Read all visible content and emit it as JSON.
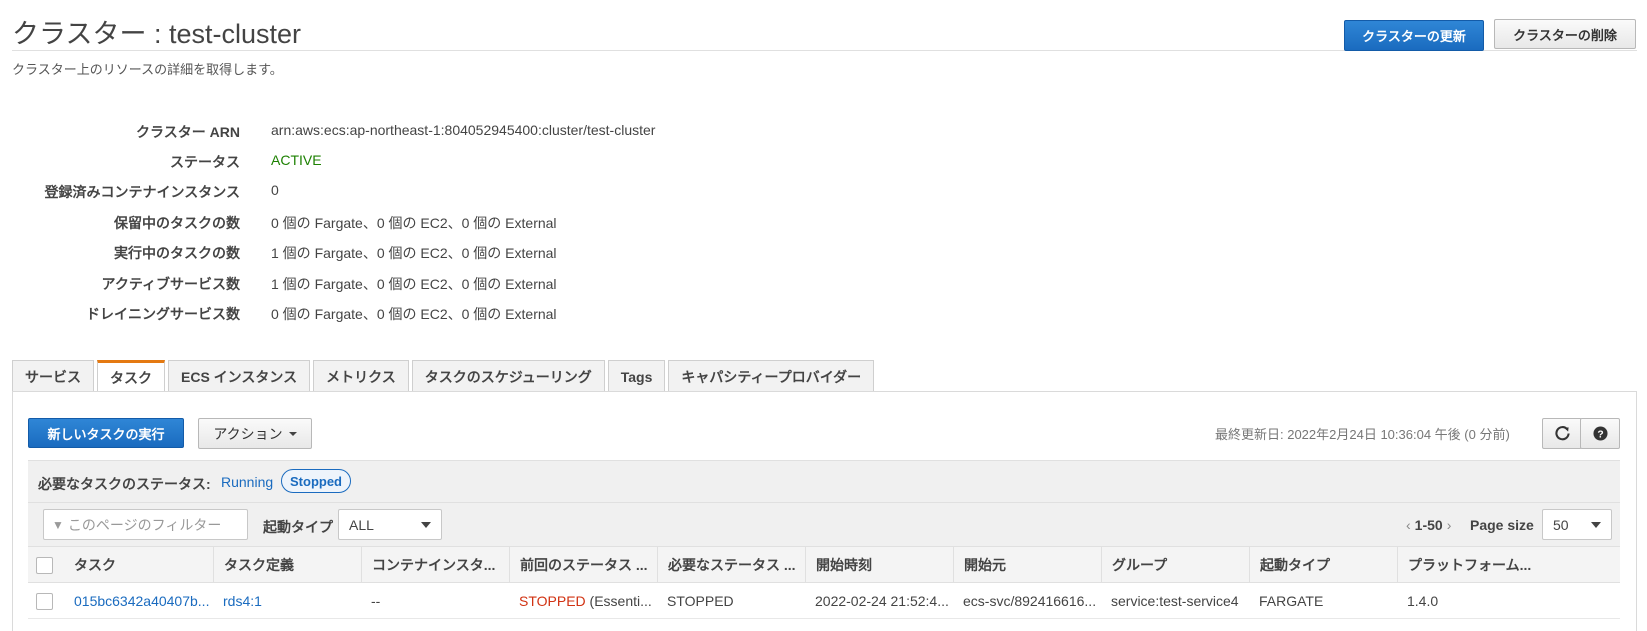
{
  "header": {
    "title": "クラスター : test-cluster",
    "subtitle": "クラスター上のリソースの詳細を取得します。",
    "update_button": "クラスターの更新",
    "delete_button": "クラスターの削除"
  },
  "details": [
    {
      "label": "クラスター ARN",
      "value": "arn:aws:ecs:ap-northeast-1:804052945400:cluster/test-cluster"
    },
    {
      "label": "ステータス",
      "value": "ACTIVE"
    },
    {
      "label": "登録済みコンテナインスタンス",
      "value": "0"
    },
    {
      "label": "保留中のタスクの数",
      "value": "0 個の Fargate、0 個の EC2、0 個の External"
    },
    {
      "label": "実行中のタスクの数",
      "value": "1 個の Fargate、0 個の EC2、0 個の External"
    },
    {
      "label": "アクティブサービス数",
      "value": "1 個の Fargate、0 個の EC2、0 個の External"
    },
    {
      "label": "ドレイニングサービス数",
      "value": "0 個の Fargate、0 個の EC2、0 個の External"
    }
  ],
  "tabs": [
    {
      "label": "サービス"
    },
    {
      "label": "タスク",
      "active": true
    },
    {
      "label": "ECS インスタンス"
    },
    {
      "label": "メトリクス"
    },
    {
      "label": "タスクのスケジューリング"
    },
    {
      "label": "Tags"
    },
    {
      "label": "キャパシティープロバイダー"
    }
  ],
  "toolbar": {
    "run_task_button": "新しいタスクの実行",
    "actions_button": "アクション",
    "last_updated": "最終更新日: 2022年2月24日 10:36:04 午後 (0 分前)",
    "refresh_icon": "refresh-icon",
    "help_icon": "help-icon"
  },
  "status_filter": {
    "label": "必要なタスクのステータス:",
    "running": "Running",
    "stopped": "Stopped"
  },
  "filter": {
    "placeholder": "このページのフィルター",
    "launch_type_label": "起動タイプ",
    "launch_type_value": "ALL",
    "pager_range": "1-50",
    "page_size_label": "Page size",
    "page_size_value": "50"
  },
  "table": {
    "columns": [
      "タスク",
      "タスク定義",
      "コンテナインスタ...",
      "前回のステータス ...",
      "必要なステータス ...",
      "開始時刻",
      "開始元",
      "グループ",
      "起動タイプ",
      "プラットフォーム..."
    ],
    "rows": [
      {
        "task": "015bc6342a40407b...",
        "task_definition": "rds4:1",
        "container_instance": "--",
        "last_status": "STOPPED",
        "last_status_detail": " (Essenti...",
        "desired_status": "STOPPED",
        "started_at": "2022-02-24 21:52:4...",
        "started_by": "ecs-svc/892416616...",
        "group": "service:test-service4",
        "launch_type": "FARGATE",
        "platform": "1.4.0"
      }
    ]
  },
  "colors": {
    "primary": "#1a6bbf",
    "active_status": "#1d8102",
    "stopped_status": "#d13212",
    "active_tab_accent": "#e47911"
  }
}
